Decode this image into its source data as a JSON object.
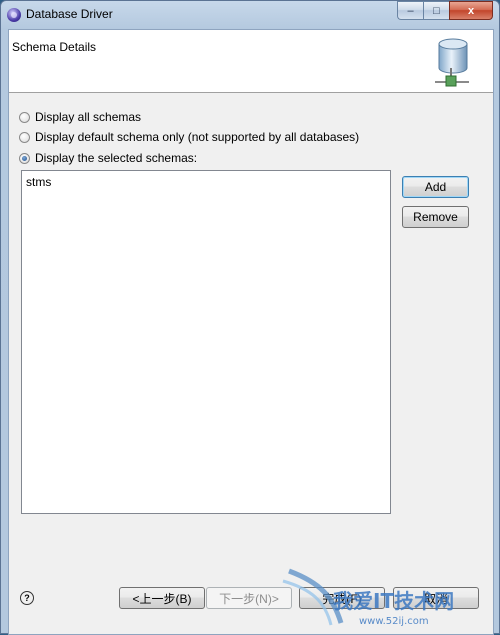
{
  "window": {
    "title": "Database Driver",
    "controls": {
      "minimize": "–",
      "maximize": "□",
      "close": "x"
    }
  },
  "banner": {
    "title": "Schema Details",
    "icon": "database-schema-icon"
  },
  "options": [
    {
      "label": "Display all schemas",
      "checked": false
    },
    {
      "label": "Display default schema only (not supported by all databases)",
      "checked": false
    },
    {
      "label": "Display the selected schemas:",
      "checked": true
    }
  ],
  "schemas": [
    "stms"
  ],
  "side_buttons": {
    "add": "Add",
    "remove": "Remove"
  },
  "footer": {
    "help_icon": "?",
    "back": "<上一步(B)",
    "next": "下一步(N)>",
    "finish": "完成(F)",
    "cancel": "取消",
    "watermark_text": "我爱IT技术网",
    "watermark_url": "www.52ij.com"
  },
  "colors": {
    "title_bar": "#b9cde3",
    "selection_accent": "#3c7fb1",
    "close_button": "#c2452b"
  }
}
